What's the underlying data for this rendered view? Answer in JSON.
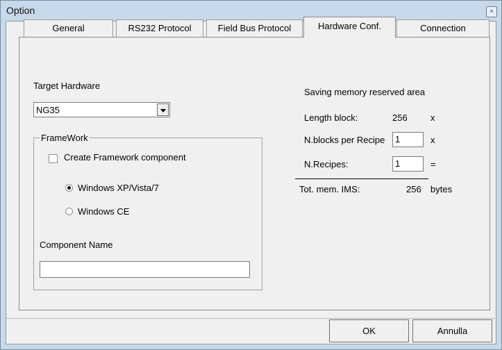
{
  "window": {
    "title": "Option",
    "close_glyph": "×"
  },
  "tabs": [
    {
      "label": "General"
    },
    {
      "label": "RS232 Protocol"
    },
    {
      "label": "Field Bus Protocol"
    },
    {
      "label": "Hardware Conf."
    },
    {
      "label": "Connection"
    }
  ],
  "active_tab": "Hardware Conf.",
  "hardware": {
    "target_label": "Target Hardware",
    "target_value": "NG35",
    "framework": {
      "group_title": "FrameWork",
      "create_label": "Create Framework component",
      "create_checked": false,
      "options": [
        {
          "label": "Windows XP/Vista/7",
          "selected": true
        },
        {
          "label": "Windows CE",
          "selected": false
        }
      ],
      "component_name_label": "Component Name",
      "component_name_value": ""
    }
  },
  "memory": {
    "title": "Saving memory reserved area",
    "length_block_label": "Length block:",
    "length_block_value": "256",
    "op_x1": "x",
    "blocks_label": "N.blocks per Recipe",
    "blocks_value": "1",
    "op_x2": "x",
    "recipes_label": "N.Recipes:",
    "recipes_value": "1",
    "op_eq": "=",
    "total_label": "Tot. mem. IMS:",
    "total_value": "256",
    "total_unit": "bytes"
  },
  "buttons": {
    "ok": "OK",
    "cancel": "Annulla"
  },
  "colors": {
    "titlebar": "#c9d9ec",
    "dialog": "#f0f0f0"
  }
}
